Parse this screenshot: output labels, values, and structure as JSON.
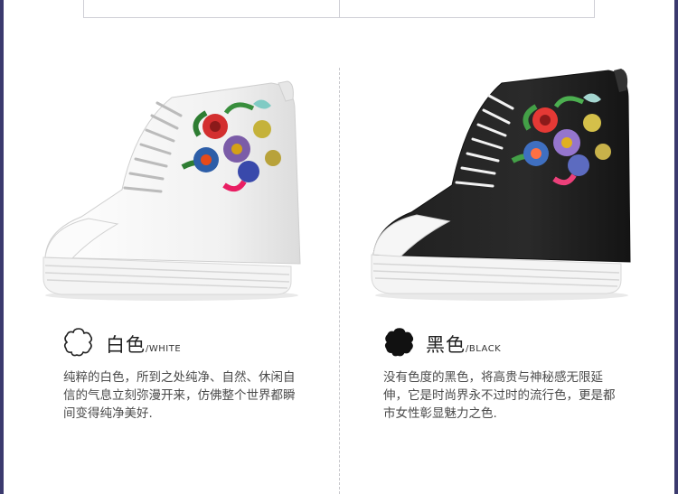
{
  "colors": {
    "frame": "#3b3a6e",
    "divider": "#c8c8cc"
  },
  "variants": [
    {
      "swatch_icon": "flower-outline-icon",
      "name_cn": "白色",
      "name_en": "/WHITE",
      "description": "纯粹的白色，所到之处纯净、自然、休闲自信的气息立刻弥漫开来，仿佛整个世界都瞬间变得纯净美好."
    },
    {
      "swatch_icon": "flower-filled-icon",
      "name_cn": "黑色",
      "name_en": "/BLACK",
      "description": "没有色度的黑色，将高贵与神秘感无限延伸，它是时尚界永不过时的流行色，更是都市女性彰显魅力之色."
    }
  ]
}
